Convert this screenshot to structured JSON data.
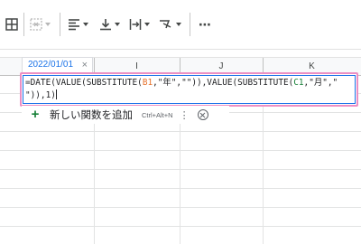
{
  "toolbar": {
    "buttons": [
      {
        "name": "borders-icon"
      },
      {
        "name": "merge-cells-icon"
      },
      {
        "name": "horizontal-align-icon"
      },
      {
        "name": "vertical-align-icon"
      },
      {
        "name": "text-wrapping-icon"
      },
      {
        "name": "text-rotation-icon"
      },
      {
        "name": "more-options-icon"
      }
    ],
    "more_label": "⋯"
  },
  "grid": {
    "columns": [
      "I",
      "J",
      "K"
    ]
  },
  "name_chip": {
    "text": "2022/01/01",
    "close": "×"
  },
  "formula": {
    "line1_prefix": "=DATE(VALUE(SUBSTITUTE(",
    "ref_b": "B1",
    "line1_mid": ",\"年\",\"\")),VALUE(SUBSTITUTE(",
    "ref_c": "C1",
    "line1_suffix": ",\"月\",\"",
    "line2": "\")),1)"
  },
  "suggestion": {
    "plus": "+",
    "label": "新しい関数を追加",
    "shortcut": "Ctrl+Alt+N",
    "menu": "⋮"
  },
  "colors": {
    "accent_blue": "#1a73e8",
    "highlight_pink": "#ec8fc3",
    "ref_b_orange": "#e6712b",
    "ref_c_green": "#188038"
  }
}
